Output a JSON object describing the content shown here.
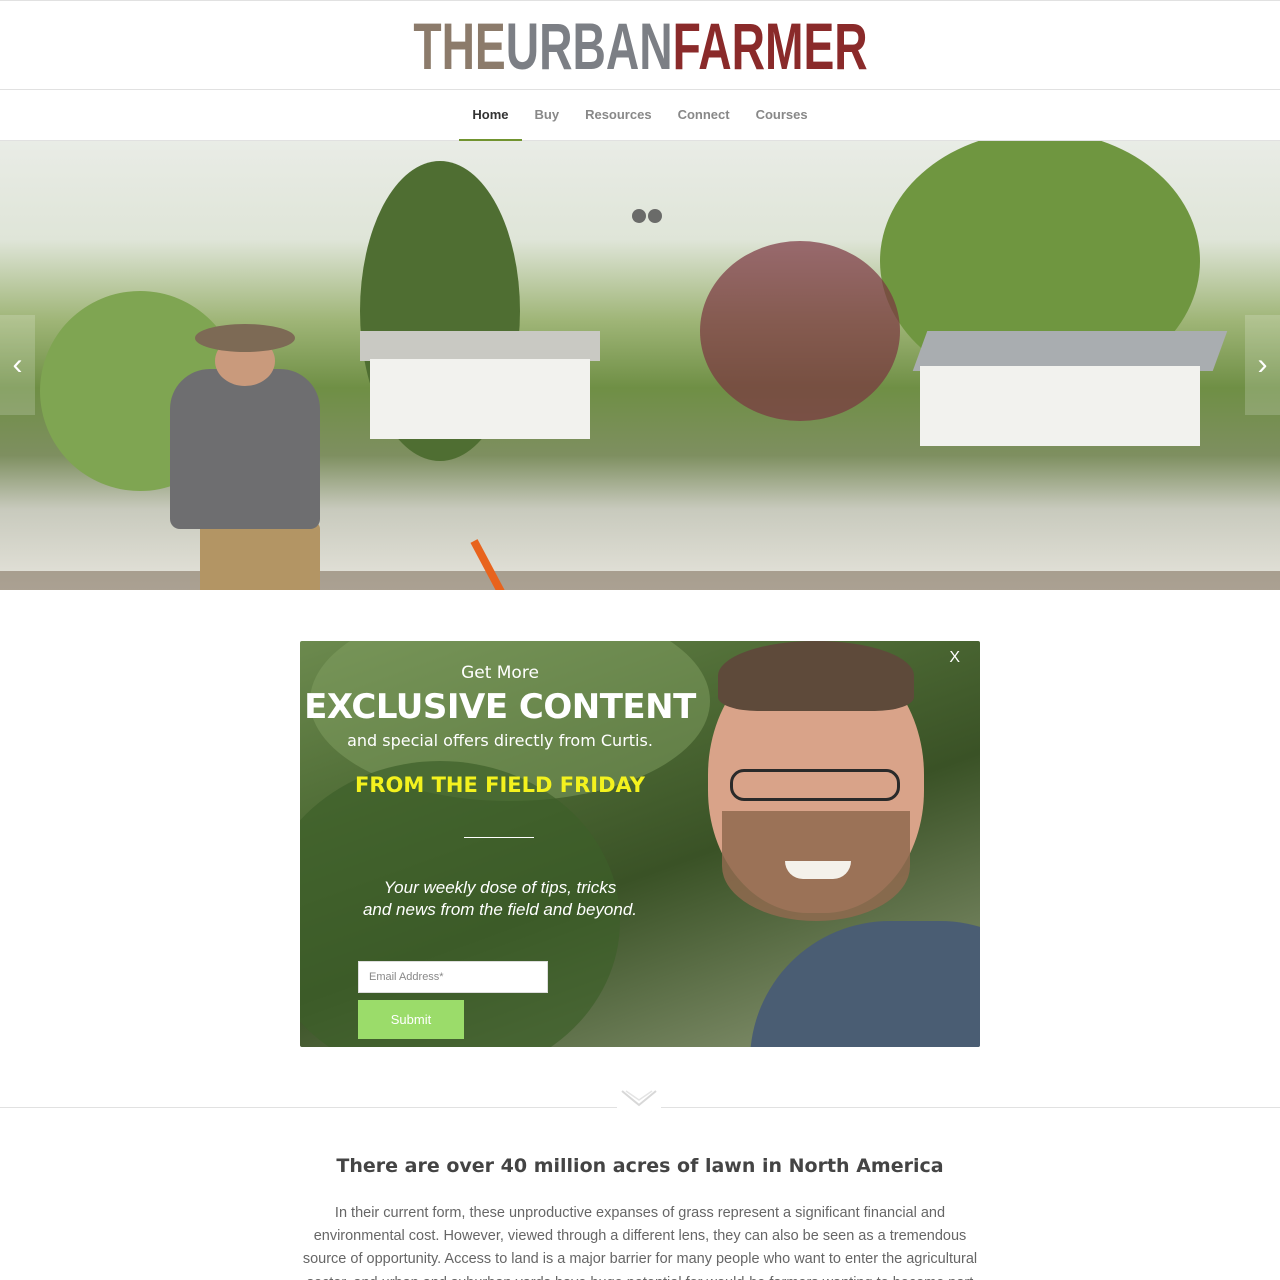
{
  "logo": {
    "the": "THE",
    "urban": "URBAN",
    "farmer": "FARMER"
  },
  "nav": {
    "items": [
      {
        "label": "Home",
        "active": true
      },
      {
        "label": "Buy",
        "active": false
      },
      {
        "label": "Resources",
        "active": false
      },
      {
        "label": "Connect",
        "active": false
      },
      {
        "label": "Courses",
        "active": false
      }
    ]
  },
  "slider": {
    "prev_icon": "chevron-left-icon",
    "next_icon": "chevron-right-icon",
    "prev_glyph": "‹",
    "next_glyph": "›",
    "dots": 2
  },
  "optin": {
    "close_label": "X",
    "get_more": "Get More",
    "headline": "EXCLUSIVE CONTENT",
    "subline": "and special offers directly from Curtis.",
    "friday": "FROM THE FIELD FRIDAY",
    "tagline_1": "Your weekly dose of tips, tricks",
    "tagline_2": "and news from the field and beyond.",
    "email_placeholder": "Email Address*",
    "submit_label": "Submit"
  },
  "content": {
    "title": "There are over 40 million acres of lawn in North America",
    "body": "In their current form, these unproductive expanses of grass represent a significant financial and environmental cost. However, viewed through a different lens, they can also be seen as a tremendous source of opportunity. Access to land is a major barrier for many people who want to enter the agricultural sector, and urban and suburban yards have huge potential for would-be farmers wanting to become part of this growing"
  },
  "colors": {
    "accent": "#719430",
    "submit": "#9bdc6a",
    "friday": "#f4f21e",
    "logo_farmer": "#8a2a2a"
  }
}
